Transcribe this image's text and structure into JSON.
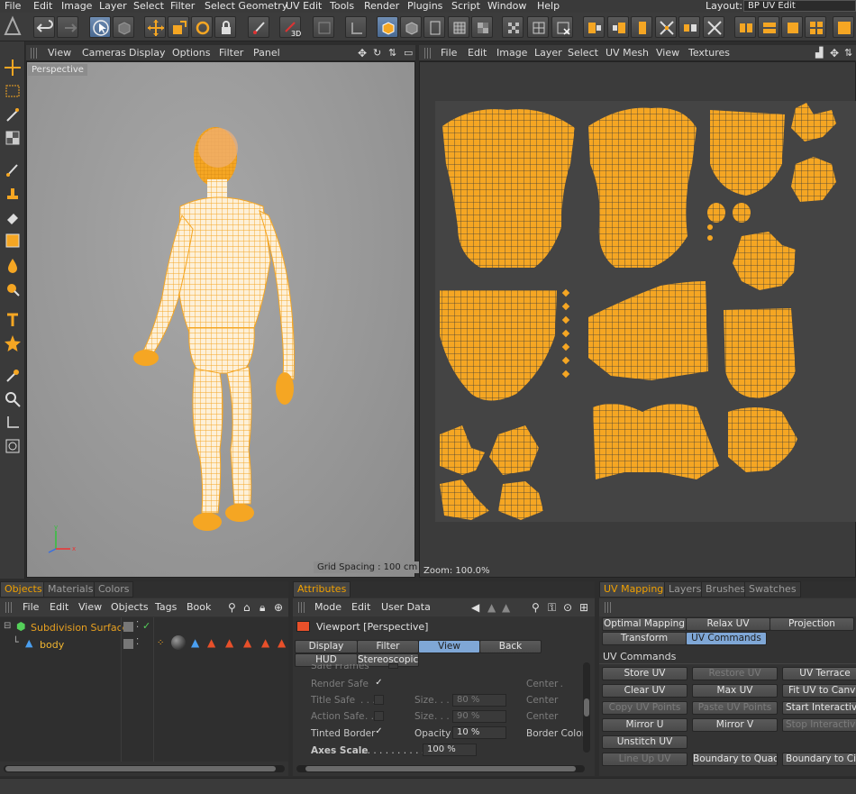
{
  "menubar": {
    "items": [
      "File",
      "Edit",
      "Image",
      "Layer",
      "Select",
      "Filter",
      "Select Geometry",
      "UV Edit",
      "Tools",
      "Render",
      "Plugins",
      "Script",
      "Window",
      "Help"
    ],
    "layout_label": "Layout:",
    "layout_value": "BP UV Edit"
  },
  "viewport": {
    "menu": [
      "View",
      "Cameras",
      "Display",
      "Options",
      "Filter",
      "Panel"
    ],
    "label": "Perspective",
    "grid_spacing": "Grid Spacing : 100 cm"
  },
  "uv_view": {
    "menu": [
      "File",
      "Edit",
      "Image",
      "Layer",
      "Select",
      "UV Mesh",
      "View",
      "Textures"
    ],
    "zoom": "Zoom: 100.0%"
  },
  "objects_panel": {
    "tabs": [
      "Objects",
      "Materials",
      "Colors"
    ],
    "menu": [
      "File",
      "Edit",
      "View",
      "Objects",
      "Tags",
      "Book"
    ],
    "tree": [
      {
        "name": "Subdivision Surface",
        "color": "#e8a020"
      },
      {
        "name": "body",
        "color": "#f2b630"
      }
    ]
  },
  "attributes_panel": {
    "tab": "Attributes",
    "menu": [
      "Mode",
      "Edit",
      "User Data"
    ],
    "object_label": "Viewport [Perspective]",
    "tabs_row1": [
      "Display",
      "Filter",
      "View",
      "Back"
    ],
    "tabs_row2": [
      "HUD",
      "Stereoscopic"
    ],
    "cut_label": "Safe Frames",
    "rows": [
      {
        "label": "Render Safe",
        "checked": true,
        "size_label": "",
        "value": "",
        "right": "Center"
      },
      {
        "label": "Title Safe",
        "checked": false,
        "size_label": "Size",
        "value": "80 %",
        "right": "Center"
      },
      {
        "label": "Action Safe",
        "checked": false,
        "size_label": "Size",
        "value": "90 %",
        "right": "Center"
      },
      {
        "label": "Tinted Border",
        "checked": true,
        "size_label": "Opacity",
        "value": "10 %",
        "right": "Border Color"
      },
      {
        "label": "Axes Scale",
        "checked": false,
        "size_label": "",
        "value": "100 %",
        "right": ""
      }
    ]
  },
  "uv_panel": {
    "tabs": [
      "UV Mapping",
      "Layers",
      "Brushes",
      "Swatches"
    ],
    "subtabs": [
      "Optimal Mapping",
      "Relax UV",
      "Projection",
      "Transform",
      "UV Commands"
    ],
    "section_title": "UV Commands",
    "buttons": [
      [
        "Store UV",
        "Restore UV",
        "UV Terrace"
      ],
      [
        "Clear UV",
        "Max UV",
        "Fit UV to Canvas"
      ],
      [
        "Copy UV Points",
        "Paste UV Points",
        "Start Interactive Mapping"
      ],
      [
        "Mirror U",
        "Mirror V",
        "Stop Interactive Mapping"
      ],
      [
        "Unstitch UV",
        "",
        ""
      ],
      [
        "Line Up UV",
        "Boundary to Quad",
        "Boundary to Circle"
      ]
    ]
  },
  "colors": {
    "accent": "#f0a000",
    "mesh": "#f5a623",
    "selected_blue": "#7fa7d6"
  }
}
